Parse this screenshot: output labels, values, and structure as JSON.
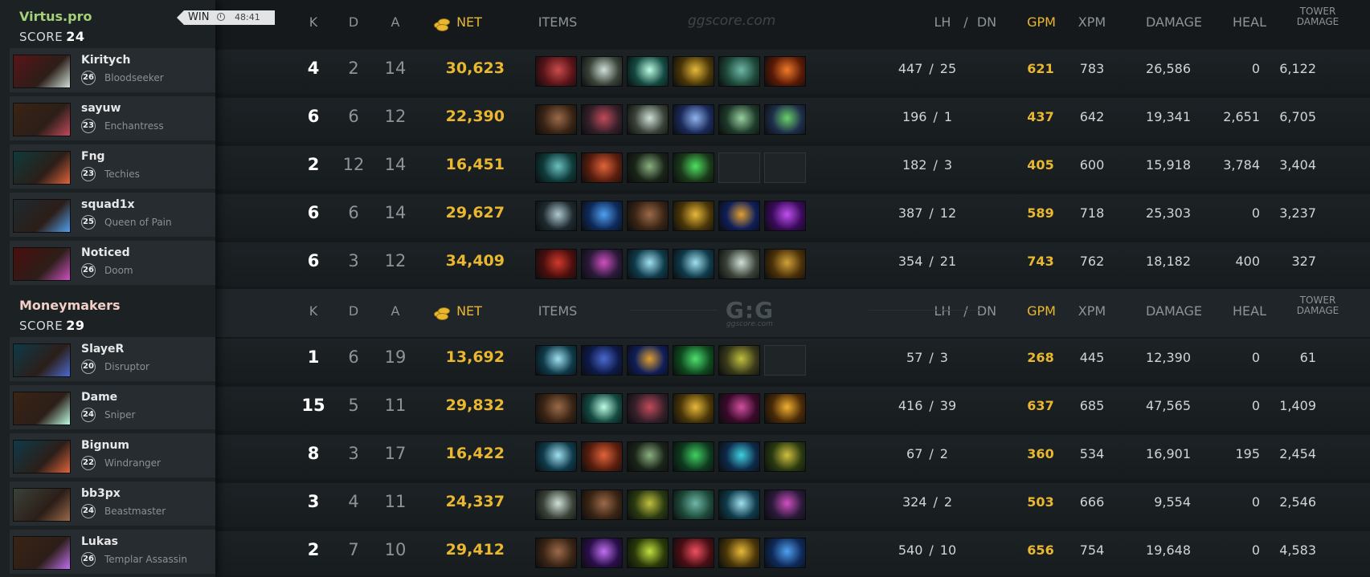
{
  "colors": {
    "gold": "#e9b730",
    "radiant_name": "#a4d07a",
    "dire_name": "#f1cfc6"
  },
  "watermark": "ggscore.com",
  "logo": {
    "mark": "G:G",
    "sub": "ggscore.com"
  },
  "headers": {
    "k": "K",
    "d": "D",
    "a": "A",
    "net": "NET",
    "items": "ITEMS",
    "lh": "LH",
    "slash": "/",
    "dn": "DN",
    "gpm": "GPM",
    "xpm": "XPM",
    "damage": "DAMAGE",
    "heal": "HEAL",
    "tower_line1": "TOWER",
    "tower_line2": "DAMAGE"
  },
  "teams": [
    {
      "name": "Virtus.pro",
      "score_label": "SCORE",
      "score": "24",
      "result": "WIN",
      "duration": "48:41",
      "players": [
        {
          "name": "Kiritych",
          "level": "26",
          "hero": "Bloodseeker",
          "portrait": "bloodseeker-portrait",
          "k": "4",
          "d": "2",
          "a": "14",
          "net": "30,623",
          "lh": "447",
          "dn": "25",
          "gpm": "621",
          "xpm": "783",
          "damage": "26,586",
          "heal": "0",
          "tower": "6,122",
          "items": [
            {
              "name": "ring-item-icon",
              "c1": "#5a1418",
              "c2": "#c94b4b"
            },
            {
              "name": "butterfly-item-icon",
              "c1": "#3a4238",
              "c2": "#cfe0d8"
            },
            {
              "name": "diffusal-item-icon",
              "c1": "#144a42",
              "c2": "#bdfde4"
            },
            {
              "name": "helm-item-icon",
              "c1": "#4a3608",
              "c2": "#e7b93a"
            },
            {
              "name": "armor-item-icon",
              "c1": "#1e4a3a",
              "c2": "#6fb7a8"
            },
            {
              "name": "fire-item-icon",
              "c1": "#5a1a06",
              "c2": "#f07a2a"
            }
          ]
        },
        {
          "name": "sayuw",
          "level": "23",
          "hero": "Enchantress",
          "portrait": "enchantress-portrait",
          "k": "6",
          "d": "6",
          "a": "12",
          "net": "22,390",
          "lh": "196",
          "dn": "1",
          "gpm": "437",
          "xpm": "642",
          "damage": "19,341",
          "heal": "2,651",
          "tower": "6,705",
          "items": [
            {
              "name": "boots-item-icon",
              "c1": "#3a2414",
              "c2": "#9a6a4a"
            },
            {
              "name": "gauntlet-item-icon",
              "c1": "#36202a",
              "c2": "#c24a5a"
            },
            {
              "name": "butterfly-item-icon",
              "c1": "#3a4238",
              "c2": "#cfe0d8"
            },
            {
              "name": "crystal-item-icon",
              "c1": "#1a2a5a",
              "c2": "#8fb4f0"
            },
            {
              "name": "staff-item-icon",
              "c1": "#1e3a2a",
              "c2": "#9ad0a0"
            },
            {
              "name": "emerald-item-icon",
              "c1": "#1e2e4a",
              "c2": "#6ad06a"
            }
          ]
        },
        {
          "name": "Fng",
          "level": "23",
          "hero": "Techies",
          "portrait": "techies-portrait",
          "k": "2",
          "d": "12",
          "a": "14",
          "net": "16,451",
          "lh": "182",
          "dn": "3",
          "gpm": "405",
          "xpm": "600",
          "damage": "15,918",
          "heal": "3,784",
          "tower": "3,404",
          "items": [
            {
              "name": "armor-item-icon",
              "c1": "#0e3a3a",
              "c2": "#6ac0c0"
            },
            {
              "name": "shield-item-icon",
              "c1": "#5a1e0e",
              "c2": "#e0643a"
            },
            {
              "name": "wand-item-icon",
              "c1": "#1a2418",
              "c2": "#8ab080"
            },
            {
              "name": "orb-item-icon",
              "c1": "#1a3a1a",
              "c2": "#50e060"
            },
            {
              "name": "empty-slot",
              "c1": "",
              "c2": ""
            },
            {
              "name": "empty-slot",
              "c1": "",
              "c2": ""
            }
          ]
        },
        {
          "name": "squad1x",
          "level": "25",
          "hero": "Queen of Pain",
          "portrait": "queen-of-pain-portrait",
          "k": "6",
          "d": "6",
          "a": "14",
          "net": "29,627",
          "lh": "387",
          "dn": "12",
          "gpm": "589",
          "xpm": "718",
          "damage": "25,303",
          "heal": "0",
          "tower": "3,237",
          "items": [
            {
              "name": "skull-item-icon",
              "c1": "#1e2a30",
              "c2": "#b0c8d0"
            },
            {
              "name": "sphere-item-icon",
              "c1": "#0e2a5a",
              "c2": "#50a0f0"
            },
            {
              "name": "boots-item-icon",
              "c1": "#3a2414",
              "c2": "#9a6a4a"
            },
            {
              "name": "helm-item-icon",
              "c1": "#4a3608",
              "c2": "#e7b93a"
            },
            {
              "name": "scepter-item-icon",
              "c1": "#0e1e5a",
              "c2": "#e0a030"
            },
            {
              "name": "dagon-item-icon",
              "c1": "#3a0a5a",
              "c2": "#c050f0"
            }
          ]
        },
        {
          "name": "Noticed",
          "level": "26",
          "hero": "Doom",
          "portrait": "doom-portrait",
          "k": "6",
          "d": "3",
          "a": "12",
          "net": "34,409",
          "lh": "354",
          "dn": "21",
          "gpm": "743",
          "xpm": "762",
          "damage": "18,182",
          "heal": "400",
          "tower": "327",
          "items": [
            {
              "name": "blade-item-icon",
              "c1": "#4a0e0e",
              "c2": "#d03a2a"
            },
            {
              "name": "gem-item-icon",
              "c1": "#2a1a3a",
              "c2": "#d050c0"
            },
            {
              "name": "axe-item-icon",
              "c1": "#0e3a4a",
              "c2": "#a0e0f0"
            },
            {
              "name": "axe-item-icon",
              "c1": "#0e3a4a",
              "c2": "#a0e0f0"
            },
            {
              "name": "butterfly-item-icon",
              "c1": "#3a4238",
              "c2": "#cfe0d8"
            },
            {
              "name": "claw-item-icon",
              "c1": "#4a3008",
              "c2": "#d0a03a"
            },
            {
              "name": "helm-item-icon",
              "c1": "#4a3608",
              "c2": "#e7b93a"
            }
          ]
        }
      ]
    },
    {
      "name": "Moneymakers",
      "score_label": "SCORE",
      "score": "29",
      "players": [
        {
          "name": "SlayeR",
          "level": "20",
          "hero": "Disruptor",
          "portrait": "disruptor-portrait",
          "k": "1",
          "d": "6",
          "a": "19",
          "net": "13,692",
          "lh": "57",
          "dn": "3",
          "gpm": "268",
          "xpm": "445",
          "damage": "12,390",
          "heal": "0",
          "tower": "61",
          "items": [
            {
              "name": "axe-item-icon",
              "c1": "#0e3a4a",
              "c2": "#a0e0f0"
            },
            {
              "name": "cloak-item-icon",
              "c1": "#0e1a4a",
              "c2": "#4a6ad0"
            },
            {
              "name": "scepter-item-icon",
              "c1": "#0e1e5a",
              "c2": "#e0a030"
            },
            {
              "name": "boots-item-icon",
              "c1": "#0e4a1e",
              "c2": "#50e070"
            },
            {
              "name": "ward-item-icon",
              "c1": "#3a3a1a",
              "c2": "#c0c040"
            },
            {
              "name": "empty-slot",
              "c1": "",
              "c2": ""
            }
          ]
        },
        {
          "name": "Dame",
          "level": "24",
          "hero": "Sniper",
          "portrait": "sniper-portrait",
          "k": "15",
          "d": "5",
          "a": "11",
          "net": "29,832",
          "lh": "416",
          "dn": "39",
          "gpm": "637",
          "xpm": "685",
          "damage": "47,565",
          "heal": "0",
          "tower": "1,409",
          "items": [
            {
              "name": "boots-item-icon",
              "c1": "#3a2414",
              "c2": "#9a6a4a"
            },
            {
              "name": "diffusal-item-icon",
              "c1": "#144a42",
              "c2": "#bdfde4"
            },
            {
              "name": "gauntlet-item-icon",
              "c1": "#36202a",
              "c2": "#c24a5a"
            },
            {
              "name": "helm-item-icon",
              "c1": "#4a3608",
              "c2": "#e7b93a"
            },
            {
              "name": "dagger-item-icon",
              "c1": "#3a0a2a",
              "c2": "#d050a0"
            },
            {
              "name": "hammer-item-icon",
              "c1": "#4a2a08",
              "c2": "#f0b030"
            }
          ]
        },
        {
          "name": "Bignum",
          "level": "22",
          "hero": "Windranger",
          "portrait": "windranger-portrait",
          "k": "8",
          "d": "3",
          "a": "17",
          "net": "16,422",
          "lh": "67",
          "dn": "2",
          "gpm": "360",
          "xpm": "534",
          "damage": "16,901",
          "heal": "195",
          "tower": "2,454",
          "items": [
            {
              "name": "axe-item-icon",
              "c1": "#0e3a4a",
              "c2": "#a0e0f0"
            },
            {
              "name": "shield-item-icon",
              "c1": "#5a1e0e",
              "c2": "#e0643a"
            },
            {
              "name": "wand-item-icon",
              "c1": "#1a2418",
              "c2": "#8ab080"
            },
            {
              "name": "sword-item-icon",
              "c1": "#0e3a1e",
              "c2": "#40d060"
            },
            {
              "name": "fish-item-icon",
              "c1": "#0e2a4a",
              "c2": "#40d0e0"
            },
            {
              "name": "boots-item-icon",
              "c1": "#2a3a10",
              "c2": "#d0c040"
            }
          ]
        },
        {
          "name": "bb3px",
          "level": "24",
          "hero": "Beastmaster",
          "portrait": "beastmaster-portrait",
          "k": "3",
          "d": "4",
          "a": "11",
          "net": "24,337",
          "lh": "324",
          "dn": "2",
          "gpm": "503",
          "xpm": "666",
          "damage": "9,554",
          "heal": "0",
          "tower": "2,546",
          "items": [
            {
              "name": "butterfly-item-icon",
              "c1": "#3a4238",
              "c2": "#cfe0d8"
            },
            {
              "name": "boots-item-icon",
              "c1": "#3a2414",
              "c2": "#9a6a4a"
            },
            {
              "name": "ring-item-icon",
              "c1": "#2a3a10",
              "c2": "#c0c040"
            },
            {
              "name": "armor-item-icon",
              "c1": "#1e4a3a",
              "c2": "#6fb7a8"
            },
            {
              "name": "axe-item-icon",
              "c1": "#0e3a4a",
              "c2": "#a0e0f0"
            },
            {
              "name": "gem-item-icon",
              "c1": "#2a1a3a",
              "c2": "#d050c0"
            }
          ]
        },
        {
          "name": "Lukas",
          "level": "26",
          "hero": "Templar Assassin",
          "portrait": "templar-assassin-portrait",
          "k": "2",
          "d": "7",
          "a": "10",
          "net": "29,412",
          "lh": "540",
          "dn": "10",
          "gpm": "656",
          "xpm": "754",
          "damage": "19,648",
          "heal": "0",
          "tower": "4,583",
          "items": [
            {
              "name": "boots-item-icon",
              "c1": "#3a2414",
              "c2": "#9a6a4a"
            },
            {
              "name": "star-item-icon",
              "c1": "#2a0e4a",
              "c2": "#c070f0"
            },
            {
              "name": "blade-item-icon",
              "c1": "#2a3a08",
              "c2": "#c0e040"
            },
            {
              "name": "sickle-item-icon",
              "c1": "#4a0e14",
              "c2": "#f05060"
            },
            {
              "name": "helm-item-icon",
              "c1": "#4a3608",
              "c2": "#e7b93a"
            },
            {
              "name": "sphere-item-icon",
              "c1": "#0e2a5a",
              "c2": "#50a0f0"
            }
          ]
        }
      ]
    }
  ]
}
